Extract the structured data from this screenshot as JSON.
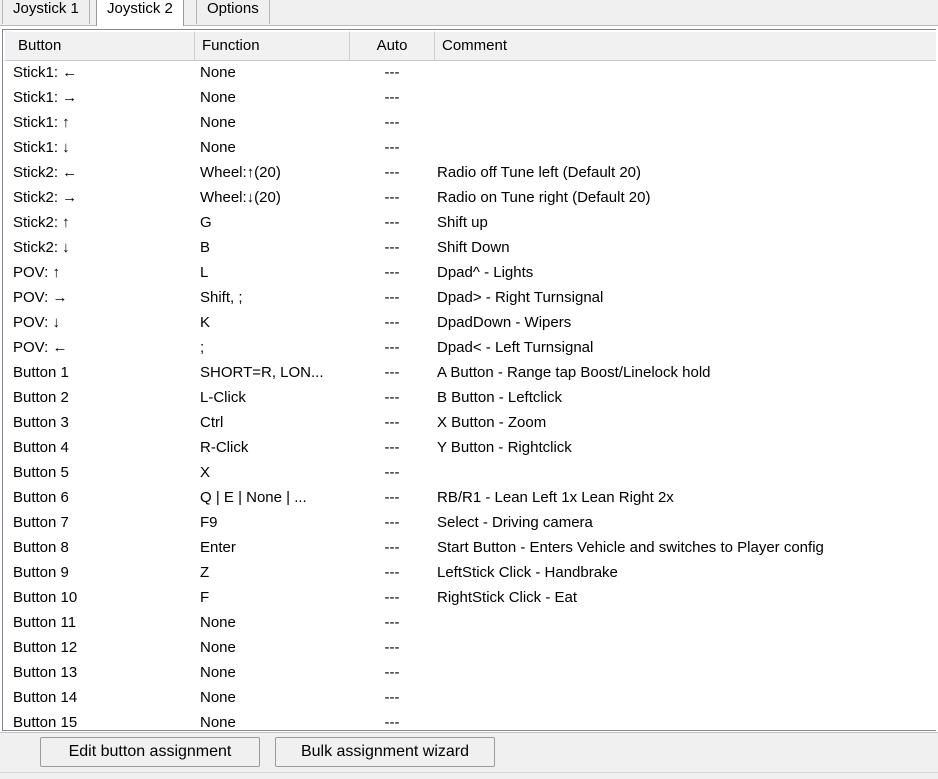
{
  "tabs": [
    {
      "label": "Joystick 1",
      "active": false
    },
    {
      "label": "Joystick 2",
      "active": true
    },
    {
      "label": "Options",
      "active": false
    }
  ],
  "table": {
    "columns": [
      "Button",
      "Function",
      "Auto",
      "Comment"
    ],
    "rows": [
      {
        "button": "Stick1: ←",
        "function": "None",
        "auto": "---",
        "comment": ""
      },
      {
        "button": "Stick1: →",
        "function": "None",
        "auto": "---",
        "comment": ""
      },
      {
        "button": "Stick1: ↑",
        "function": "None",
        "auto": "---",
        "comment": ""
      },
      {
        "button": "Stick1: ↓",
        "function": "None",
        "auto": "---",
        "comment": ""
      },
      {
        "button": "Stick2: ←",
        "function": "Wheel:↑(20)",
        "auto": "---",
        "comment": "Radio off Tune left (Default 20)"
      },
      {
        "button": "Stick2: →",
        "function": "Wheel:↓(20)",
        "auto": "---",
        "comment": "Radio on Tune right (Default 20)"
      },
      {
        "button": "Stick2: ↑",
        "function": "G",
        "auto": "---",
        "comment": "Shift up"
      },
      {
        "button": "Stick2: ↓",
        "function": "B",
        "auto": "---",
        "comment": "Shift Down"
      },
      {
        "button": "POV: ↑",
        "function": "L",
        "auto": "---",
        "comment": "Dpad^ - Lights"
      },
      {
        "button": "POV: →",
        "function": "Shift, ;",
        "auto": "---",
        "comment": "Dpad> - Right Turnsignal"
      },
      {
        "button": "POV: ↓",
        "function": "K",
        "auto": "---",
        "comment": "DpadDown - Wipers"
      },
      {
        "button": "POV: ←",
        "function": ";",
        "auto": "---",
        "comment": "Dpad< - Left Turnsignal"
      },
      {
        "button": "Button 1",
        "function": "SHORT=R, LON...",
        "auto": "---",
        "comment": "A Button - Range tap Boost/Linelock hold"
      },
      {
        "button": "Button 2",
        "function": "L-Click",
        "auto": "---",
        "comment": "B Button - Leftclick"
      },
      {
        "button": "Button 3",
        "function": "Ctrl",
        "auto": "---",
        "comment": "X Button -  Zoom"
      },
      {
        "button": "Button 4",
        "function": "R-Click",
        "auto": "---",
        "comment": "Y Button - Rightclick"
      },
      {
        "button": "Button 5",
        "function": "X",
        "auto": "---",
        "comment": ""
      },
      {
        "button": "Button 6",
        "function": "Q | E | None | ...",
        "auto": "---",
        "comment": "RB/R1 - Lean Left 1x Lean Right 2x"
      },
      {
        "button": "Button 7",
        "function": "F9",
        "auto": "---",
        "comment": "Select -  Driving camera"
      },
      {
        "button": "Button 8",
        "function": "Enter",
        "auto": "---",
        "comment": "Start Button - Enters Vehicle and switches to Player config"
      },
      {
        "button": "Button 9",
        "function": "Z",
        "auto": "---",
        "comment": "LeftStick Click - Handbrake"
      },
      {
        "button": "Button 10",
        "function": "F",
        "auto": "---",
        "comment": "RightStick Click - Eat"
      },
      {
        "button": "Button 11",
        "function": "None",
        "auto": "---",
        "comment": ""
      },
      {
        "button": "Button 12",
        "function": "None",
        "auto": "---",
        "comment": ""
      },
      {
        "button": "Button 13",
        "function": "None",
        "auto": "---",
        "comment": ""
      },
      {
        "button": "Button 14",
        "function": "None",
        "auto": "---",
        "comment": ""
      },
      {
        "button": "Button 15",
        "function": "None",
        "auto": "---",
        "comment": ""
      }
    ]
  },
  "buttonbar": {
    "edit_label": "Edit button assignment",
    "bulk_label": "Bulk assignment wizard"
  }
}
